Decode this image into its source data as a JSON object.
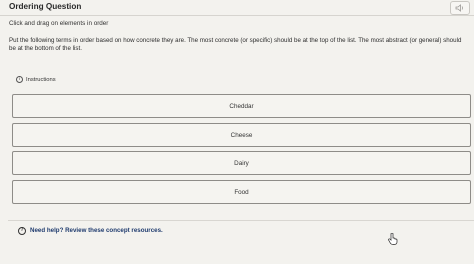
{
  "header": {
    "title": "Ordering Question"
  },
  "instruction_short": "Click and drag on elements in order",
  "prompt": "Put the following terms in order based on how concrete they are. The most concrete (or specific) should be at the top of the list. The most abstract (or general) should be at the bottom of the list.",
  "instructions_toggle": {
    "icon_text": "i",
    "label": "Instructions"
  },
  "items": [
    {
      "label": "Cheddar"
    },
    {
      "label": "Cheese"
    },
    {
      "label": "Dairy"
    },
    {
      "label": "Food"
    }
  ],
  "help": {
    "icon_text": "?",
    "label": "Need help? Review these concept resources."
  },
  "icons": {
    "audio": "speaker-icon",
    "info": "info-icon",
    "help": "question-icon",
    "cursor": "hand-cursor-icon"
  }
}
